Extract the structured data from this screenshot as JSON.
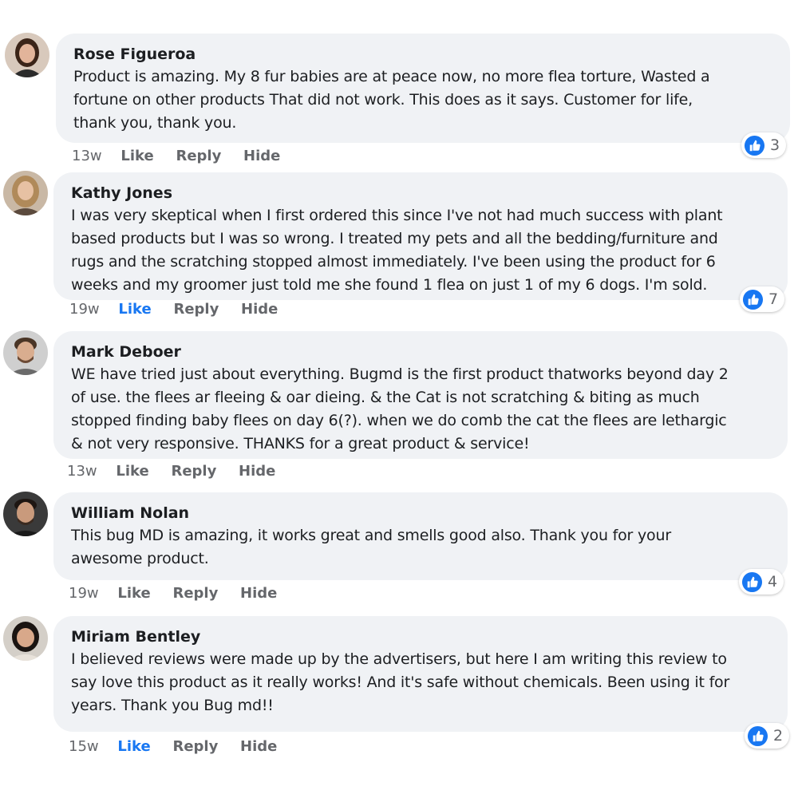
{
  "comments": [
    {
      "author": "Rose Figueroa",
      "lines": [
        "Product is amazing. My 8 fur babies are at peace now, no more flea torture, Wasted a",
        "fortune on other products That did not work.  This does as it says. Customer for life,",
        "thank you, thank you."
      ],
      "time": "13w",
      "like": "Like",
      "reply": "Reply",
      "hide": "Hide",
      "liked": false,
      "reaction_count": "3",
      "avatar_colors": {
        "bg": "#d8c9bc",
        "hair": "#3b2418",
        "skin": "#e2b49a",
        "shirt": "#2b2b2b"
      }
    },
    {
      "author": "Kathy Jones",
      "lines": [
        "I was very skeptical when I first ordered this since I've not had much success with plant",
        "based products but I was so wrong.  I treated my pets and all the bedding/furniture and",
        "rugs and the scratching stopped almost immediately.  I've been using the product for 6",
        "weeks and my groomer just told me she found 1 flea on just 1 of my 6 dogs.  I'm sold."
      ],
      "time": "19w",
      "like": "Like",
      "reply": "Reply",
      "hide": "Hide",
      "liked": true,
      "reaction_count": "7",
      "avatar_colors": {
        "bg": "#c9b8a5",
        "hair": "#b08a5a",
        "skin": "#e7c1a3",
        "shirt": "#5b4a3d"
      }
    },
    {
      "author": "Mark Deboer",
      "lines": [
        "WE have tried just about everything. Bugmd is the first product thatworks beyond day 2",
        "of use. the flees ar fleeing & oar dieing. & the Cat is not scratching & biting as much",
        "stopped finding baby flees on day 6(?). when we do comb the cat the flees are lethargic",
        "& not very responsive. THANKS for a great product & service!"
      ],
      "time": "13w",
      "like": "Like",
      "reply": "Reply",
      "hide": "Hide",
      "liked": false,
      "reaction_count": "",
      "avatar_colors": {
        "bg": "#cfcfcf",
        "hair": "#4a3526",
        "skin": "#d9ad8f",
        "shirt": "#6a6a6a"
      }
    },
    {
      "author": "William Nolan",
      "lines": [
        "This bug MD is amazing, it works great and smells good also. Thank you for your",
        "awesome product."
      ],
      "time": "19w",
      "like": "Like",
      "reply": "Reply",
      "hide": "Hide",
      "liked": false,
      "reaction_count": "4",
      "avatar_colors": {
        "bg": "#3a3a3a",
        "hair": "#1e1612",
        "skin": "#c99a7c",
        "shirt": "#1a1a1a"
      }
    },
    {
      "author": "Miriam Bentley",
      "lines": [
        "I believed reviews were made up by the advertisers,  but here I am writing this review to",
        "say love this product as it really works!  And it's safe without chemicals. Been using it for",
        "years. Thank you Bug md!!"
      ],
      "time": "15w",
      "like": "Like",
      "reply": "Reply",
      "hide": "Hide",
      "liked": true,
      "reaction_count": "2",
      "avatar_colors": {
        "bg": "#d4cfc8",
        "hair": "#1a1411",
        "skin": "#d8a88a",
        "shirt": "#e8e2da"
      }
    }
  ],
  "colors": {
    "bubble": "#f0f2f5",
    "meta": "#65676b",
    "liked": "#1877f2",
    "like_icon": "#1877f2"
  },
  "icons": {
    "reaction": "thumbs-up-icon",
    "avatar": "profile-photo"
  }
}
